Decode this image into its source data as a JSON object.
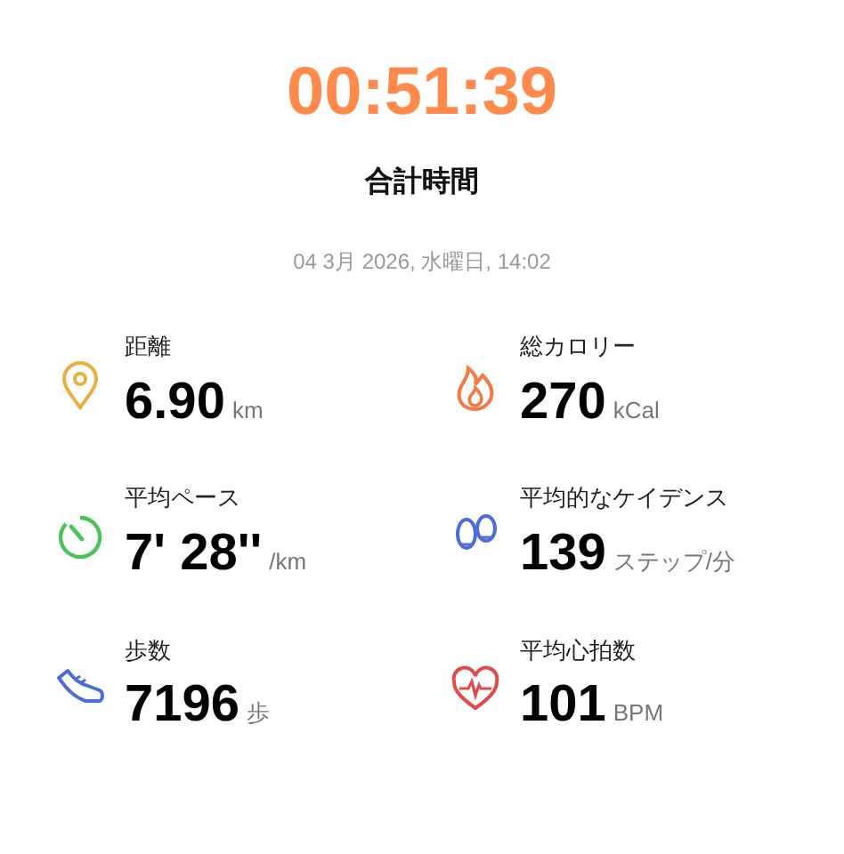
{
  "total_time": "00:51:39",
  "total_label": "合計時間",
  "date": "04 3月 2026, 水曜日, 14:02",
  "stats": [
    {
      "kind": "distance",
      "label": "距離",
      "value": "6.90",
      "unit": "km"
    },
    {
      "kind": "calories",
      "label": "総カロリー",
      "value": "270",
      "unit": "kCal"
    },
    {
      "kind": "pace",
      "label": "平均ペース",
      "value": "7' 28''",
      "unit": "/km"
    },
    {
      "kind": "cadence",
      "label": "平均的なケイデンス",
      "value": "139",
      "unit": "ステップ/分"
    },
    {
      "kind": "steps",
      "label": "歩数",
      "value": "7196",
      "unit": "歩"
    },
    {
      "kind": "heart",
      "label": "平均心拍数",
      "value": "101",
      "unit": "BPM"
    }
  ]
}
